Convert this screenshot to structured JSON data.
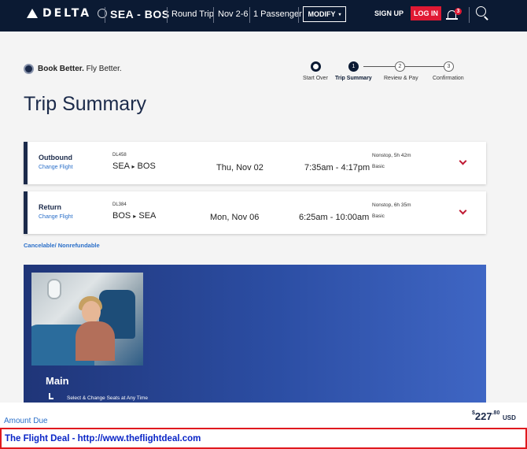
{
  "header": {
    "brand": "DELTA",
    "route": "SEA - BOS",
    "trip_type": "Round Trip",
    "dates": "Nov 2-6",
    "passengers": "1 Passenger",
    "modify_label": "MODIFY",
    "signup_label": "SIGN UP",
    "login_label": "LOG IN",
    "notification_count": "3"
  },
  "book_better": {
    "bold": "Book Better.",
    "rest": " Fly Better."
  },
  "steps": [
    {
      "label": "Start Over",
      "number": ""
    },
    {
      "label": "Trip Summary",
      "number": "1"
    },
    {
      "label": "Review & Pay",
      "number": "2"
    },
    {
      "label": "Confirmation",
      "number": "3"
    }
  ],
  "page_title": "Trip Summary",
  "flights": [
    {
      "leg": "Outbound",
      "change_label": "Change Flight",
      "flight_number": "DL458",
      "origin": "SEA",
      "destination": "BOS",
      "date": "Thu, Nov 02",
      "time": "7:35am - 4:17pm",
      "stops": "Nonstop, 5h 42m",
      "fare": "Basic"
    },
    {
      "leg": "Return",
      "change_label": "Change Flight",
      "flight_number": "DL384",
      "origin": "BOS",
      "destination": "SEA",
      "date": "Mon, Nov 06",
      "time": "6:25am - 10:00am",
      "stops": "Nonstop, 6h 35m",
      "fare": "Basic"
    }
  ],
  "cancel_note": "Cancelable/ Nonrefundable",
  "promo": {
    "title": "Main",
    "feature": "Select & Change Seats at Any Time"
  },
  "amount": {
    "label": "Amount Due",
    "currency_symbol": "$",
    "dollars": "227",
    "cents": ".80",
    "currency": "USD"
  },
  "watermark": "The Flight Deal - http://www.theflightdeal.com",
  "colors": {
    "nav_bg": "#0b1a33",
    "accent_red": "#e01933",
    "link_blue": "#2a6fc9",
    "promo_blue": "#2c4ea4"
  }
}
